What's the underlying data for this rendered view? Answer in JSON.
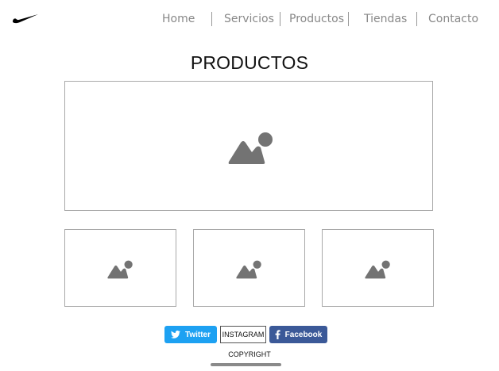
{
  "logo": {
    "icon": "swoosh-logo-icon"
  },
  "nav": {
    "items": [
      {
        "label": "Home"
      },
      {
        "label": "Servicios"
      },
      {
        "label": "Productos"
      },
      {
        "label": "Tiendas"
      },
      {
        "label": "Contacto"
      }
    ]
  },
  "page": {
    "title": "PRODUCTOS"
  },
  "products": {
    "main_image": {
      "icon": "image-placeholder-icon"
    },
    "thumbnails": [
      {
        "icon": "image-placeholder-icon"
      },
      {
        "icon": "image-placeholder-icon"
      },
      {
        "icon": "image-placeholder-icon"
      }
    ]
  },
  "footer": {
    "twitter_label": "Twitter",
    "instagram_label": "INSTAGRAM",
    "facebook_label": "Facebook",
    "copyright": "COPYRIGHT"
  },
  "colors": {
    "twitter": "#1da1f2",
    "facebook": "#3b5998",
    "placeholder_icon": "#737373",
    "frame_border": "#a9a9a9"
  }
}
